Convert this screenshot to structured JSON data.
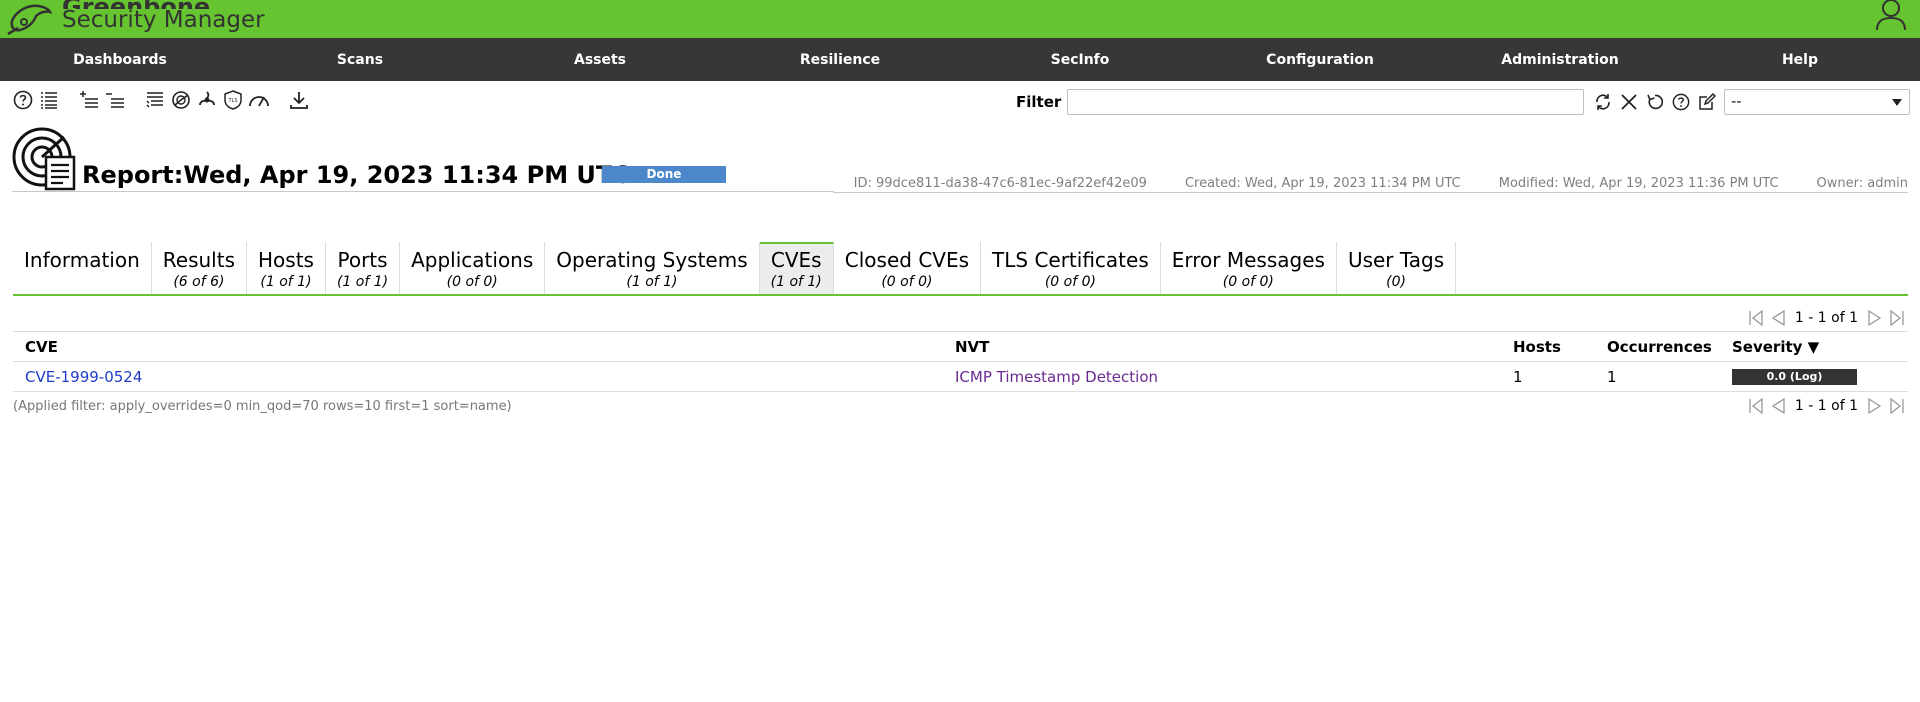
{
  "header": {
    "brand_line1": "Greenbone",
    "brand_line2": "Security Manager"
  },
  "nav": {
    "items": [
      "Dashboards",
      "Scans",
      "Assets",
      "Resilience",
      "SecInfo",
      "Configuration",
      "Administration",
      "Help"
    ]
  },
  "toolbar": {
    "filter_label": "Filter",
    "filter_value": "",
    "filter_select_value": "--"
  },
  "report": {
    "title": "Report:Wed, Apr 19, 2023 11:34 PM UTC",
    "status": "Done",
    "id": "ID: 99dce811-da38-47c6-81ec-9af22ef42e09",
    "created": "Created: Wed, Apr 19, 2023 11:34 PM UTC",
    "modified": "Modified: Wed, Apr 19, 2023 11:36 PM UTC",
    "owner": "Owner: admin"
  },
  "tabs": [
    {
      "label": "Information",
      "count": ""
    },
    {
      "label": "Results",
      "count": "(6 of 6)"
    },
    {
      "label": "Hosts",
      "count": "(1 of 1)"
    },
    {
      "label": "Ports",
      "count": "(1 of 1)"
    },
    {
      "label": "Applications",
      "count": "(0 of 0)"
    },
    {
      "label": "Operating Systems",
      "count": "(1 of 1)"
    },
    {
      "label": "CVEs",
      "count": "(1 of 1)"
    },
    {
      "label": "Closed CVEs",
      "count": "(0 of 0)"
    },
    {
      "label": "TLS Certificates",
      "count": "(0 of 0)"
    },
    {
      "label": "Error Messages",
      "count": "(0 of 0)"
    },
    {
      "label": "User Tags",
      "count": "(0)"
    }
  ],
  "active_tab": "CVEs",
  "pager": {
    "text": "1 - 1 of 1"
  },
  "table": {
    "headers": {
      "cve": "CVE",
      "nvt": "NVT",
      "hosts": "Hosts",
      "occurrences": "Occurrences",
      "severity": "Severity ▼"
    },
    "rows": [
      {
        "cve": "CVE-1999-0524",
        "nvt": "ICMP Timestamp Detection",
        "hosts": "1",
        "occurrences": "1",
        "severity": "0.0 (Log)"
      }
    ]
  },
  "applied_filter": "(Applied filter: apply_overrides=0 min_qod=70 rows=10 first=1 sort=name)",
  "colors": {
    "brand_green": "#66c430",
    "nav_bg": "#393637",
    "status_blue": "#4c87c9",
    "severity_log": "#333333"
  }
}
